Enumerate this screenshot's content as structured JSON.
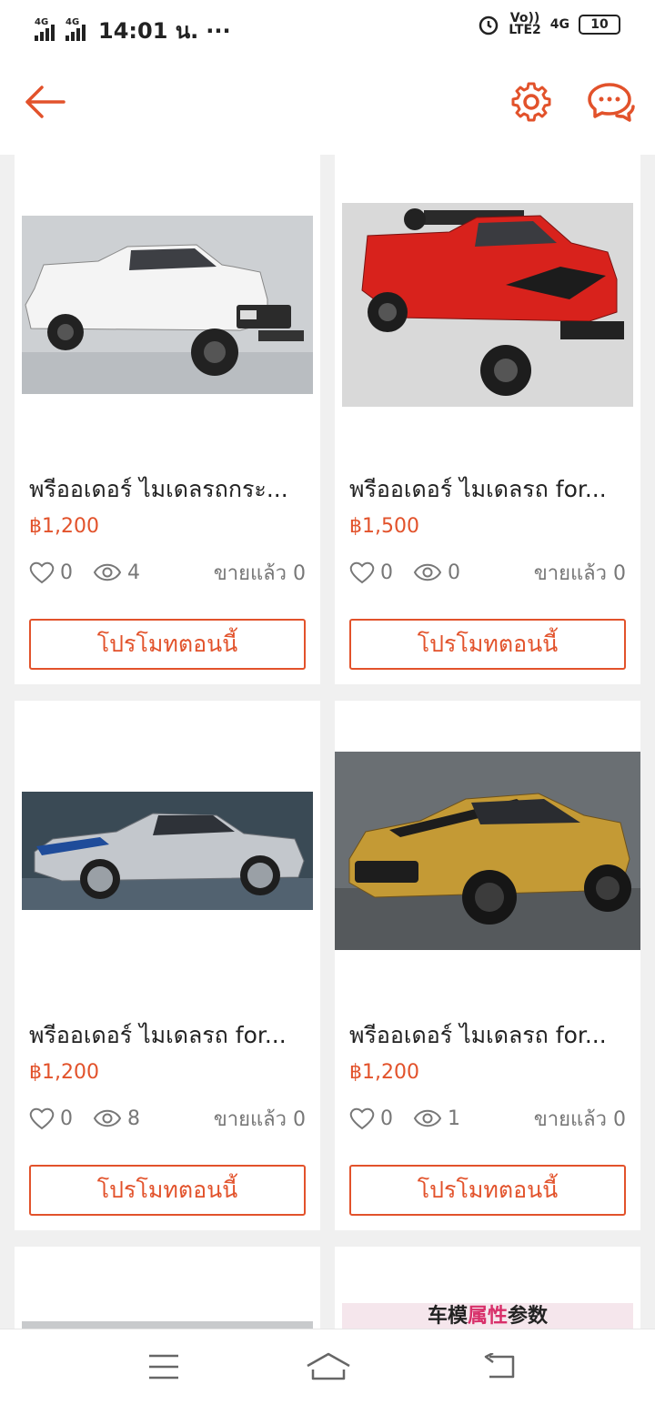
{
  "status_bar": {
    "net1": "4G",
    "net2": "4G",
    "time": "14:01 น.",
    "dots": "···",
    "volte_top": "Vo))",
    "volte_bottom": "LTE2",
    "net3": "4G",
    "battery": "10"
  },
  "header": {
    "back_icon": "arrow-left-icon",
    "settings_icon": "gear-icon",
    "chat_icon": "chat-bubbles-icon",
    "accent": "#e2522b"
  },
  "products": [
    {
      "title": "พรีออเดอร์ ไมเดลรถกระ...",
      "price": "฿1,200",
      "likes": "0",
      "views": "4",
      "sold": "ขายแล้ว 0",
      "promo": "โปรโมทตอนนี้",
      "image": "white pickup truck model"
    },
    {
      "title": "พรีออเดอร์ ไมเดลรถ for...",
      "price": "฿1,500",
      "likes": "0",
      "views": "0",
      "sold": "ขายแล้ว 0",
      "promo": "โปรโมทตอนนี้",
      "image": "red pickup truck model"
    },
    {
      "title": "พรีออเดอร์ ไมเดลรถ for...",
      "price": "฿1,200",
      "likes": "0",
      "views": "8",
      "sold": "ขายแล้ว 0",
      "promo": "โปรโมทตอนนี้",
      "image": "silver mustang model"
    },
    {
      "title": "พรีออเดอร์ ไมเดลรถ for...",
      "price": "฿1,200",
      "likes": "0",
      "views": "1",
      "sold": "ขายแล้ว 0",
      "promo": "โปรโมทตอนนี้",
      "image": "gold mustang model"
    }
  ],
  "partial_card": {
    "chinese_text_a": "车模",
    "chinese_text_b": "属性",
    "chinese_text_c": "参数"
  },
  "nav": {
    "menu_icon": "menu-icon",
    "home_icon": "home-icon",
    "back_icon": "return-icon"
  }
}
